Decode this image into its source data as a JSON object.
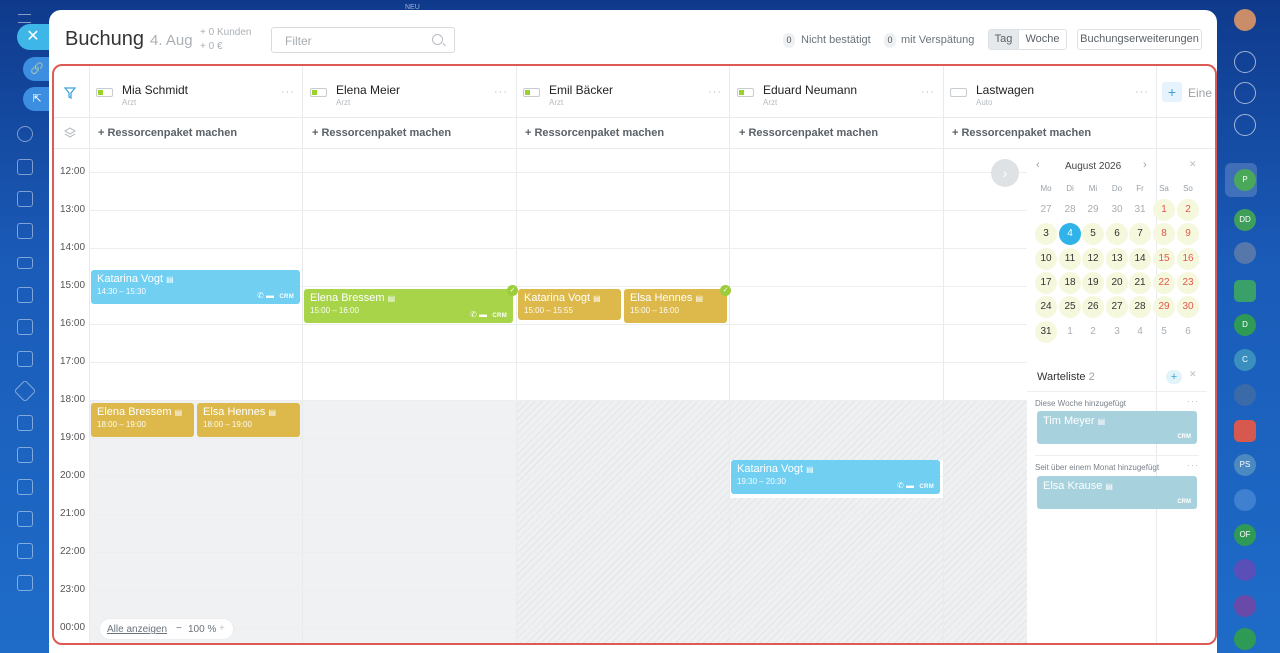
{
  "app": {
    "title": "Buchung",
    "date": "4. Aug",
    "clients": "+ 0 Kunden",
    "revenue": "+ 0 €",
    "filter_placeholder": "Filter",
    "unconfirmed_count": "0",
    "unconfirmed_label": "Nicht bestätigt",
    "late_count": "0",
    "late_label": "mit Verspätung",
    "view_day": "Tag",
    "view_week": "Woche",
    "extensions": "Buchungserweiterungen",
    "top_hint": "NEU"
  },
  "resources": [
    {
      "name": "Mia Schmidt",
      "role": "Arzt"
    },
    {
      "name": "Elena Meier",
      "role": "Arzt"
    },
    {
      "name": "Emil Bäcker",
      "role": "Arzt"
    },
    {
      "name": "Eduard Neumann",
      "role": "Arzt"
    },
    {
      "name": "Lastwagen",
      "role": "Auto"
    }
  ],
  "add_resource": "Eine",
  "package_label": "+ Ressorcenpaket machen",
  "hours": [
    "12:00",
    "13:00",
    "14:00",
    "15:00",
    "16:00",
    "17:00",
    "18:00",
    "19:00",
    "20:00",
    "21:00",
    "22:00",
    "23:00",
    "00:00"
  ],
  "events": [
    {
      "name": "Katarina Vogt",
      "time": "14:30 – 15:30",
      "crm": "CRM"
    },
    {
      "name": "Elena Bressem",
      "time": "15:00 – 16:00",
      "crm": "CRM"
    },
    {
      "name": "Katarina Vogt",
      "time": "15:00 – 15:55"
    },
    {
      "name": "Elsa Hennes",
      "time": "15:00 – 16:00"
    },
    {
      "name": "Elena Bressem",
      "time": "18:00 – 19:00"
    },
    {
      "name": "Elsa Hennes",
      "time": "18:00 – 19:00"
    },
    {
      "name": "Katarina Vogt",
      "time": "19:30 – 20:30",
      "crm": "CRM"
    }
  ],
  "calendar": {
    "month": "August 2026",
    "weekdays": [
      "Mo",
      "Di",
      "Mi",
      "Do",
      "Fr",
      "Sa",
      "So"
    ],
    "weeks": [
      [
        "27",
        "28",
        "29",
        "30",
        "31",
        "1",
        "2"
      ],
      [
        "3",
        "4",
        "5",
        "6",
        "7",
        "8",
        "9"
      ],
      [
        "10",
        "11",
        "12",
        "13",
        "14",
        "15",
        "16"
      ],
      [
        "17",
        "18",
        "19",
        "20",
        "21",
        "22",
        "23"
      ],
      [
        "24",
        "25",
        "26",
        "27",
        "28",
        "29",
        "30"
      ],
      [
        "31",
        "1",
        "2",
        "3",
        "4",
        "5",
        "6"
      ]
    ]
  },
  "waitlist": {
    "title": "Warteliste",
    "count": "2",
    "add": "+",
    "group1": "Diese Woche hinzugefügt",
    "group2": "Seit über einem Monat hinzugefügt",
    "item1": "Tim Meyer",
    "item2": "Elsa Krause",
    "crm": "CRM"
  },
  "footer": {
    "show_all": "Alle anzeigen",
    "zoom": "100 %",
    "minus": "−",
    "plus": "+"
  },
  "colors": {
    "accent": "#3fb6e8",
    "frame": "#de5a55",
    "event_blue": "#71cff2",
    "event_green": "#a7d449",
    "event_gold": "#dcb94a"
  }
}
